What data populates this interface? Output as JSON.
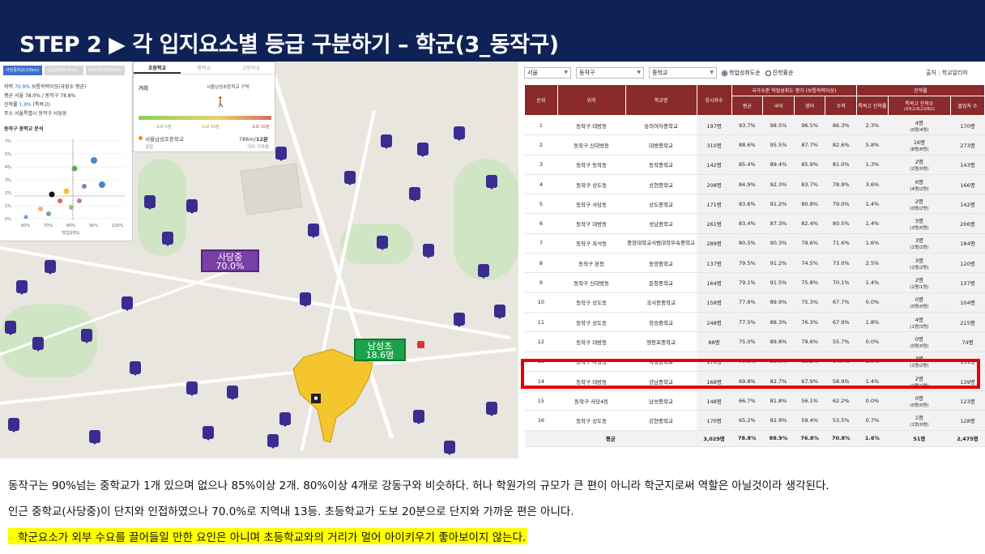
{
  "title": "STEP 2 ▶ 각 입지요소별 등급 구분하기 – 학군(3_동작구)",
  "left_panel": {
    "tabs": [
      "사당중학교(15km)",
      "성도중학교(3km)",
      "동작구중학교(8km)"
    ],
    "line1_prefix": "학력",
    "line1_value": "70.9%",
    "line1_suffix": "보통학력이상(국영수 평균)",
    "line2": "평균 서울 78.0% / 동작구 78.8%",
    "line3_prefix": "진학률",
    "line3_value": "1.9%",
    "line3_suffix": "(특목고)",
    "line4": "주소 서울특별시 동작구 사당동",
    "chart_title": "동작구 중학교 분석",
    "chart_xlabel": "학업성취도"
  },
  "school_panel": {
    "tabs": [
      "초등학교",
      "중학교",
      "고등학교"
    ],
    "distance_label": "거리",
    "school_route": "서울남성초등학교 구역",
    "legend": [
      "도보 5분",
      "도보 10분",
      "도보 20분"
    ],
    "school_name": "서울남성초등학교",
    "distance_value": "786m",
    "walk_time": "12분",
    "school_type": "공립",
    "walk_note": "거리 가까움"
  },
  "map": {
    "label_sadang_name": "사당중",
    "label_sadang_value": "70.0%",
    "label_namseong_name": "남성초",
    "label_namseong_value": "18.6명",
    "colors": {
      "sadang": "#7b3fa8",
      "namseong": "#1ca24a",
      "zone": "#f5c52e",
      "pin": "#3a2d8f"
    }
  },
  "table_panel": {
    "filter_city": "서울",
    "filter_district": "동작구",
    "filter_level": "중학교",
    "radio_1": "학업성취도순",
    "radio_2": "진학률순",
    "source": "출처 : 학교알리미",
    "headers": {
      "rank": "순위",
      "location": "위치",
      "school": "학교명",
      "applicants": "응시자수",
      "group_achievement": "국가수준 학업성취도 평가 (보통학력이상)",
      "group_progress": "진학률",
      "avg": "평균",
      "korean": "국어",
      "english": "영어",
      "math": "수학",
      "special_rate": "특목고 진학률",
      "special_count": "특목고 진학수",
      "special_count_sub": "(과학고/외고국제고)",
      "grad": "졸업자 수"
    },
    "rows": [
      {
        "rank": "1",
        "loc": "동작구 대방동",
        "school": "숭의여자중학교",
        "app": "197명",
        "avg": "93.7%",
        "kor": "98.5%",
        "eng": "96.5%",
        "math": "86.3%",
        "rate": "2.3%",
        "cnt": "4명",
        "cnt_sub": "(0명/4명)",
        "grad": "170명"
      },
      {
        "rank": "2",
        "loc": "동작구 신대방동",
        "school": "대방중학교",
        "app": "310명",
        "avg": "88.6%",
        "kor": "95.5%",
        "eng": "87.7%",
        "math": "82.6%",
        "rate": "5.8%",
        "cnt": "16명",
        "cnt_sub": "(8명/8명)",
        "grad": "273명"
      },
      {
        "rank": "3",
        "loc": "동작구 동작동",
        "school": "동작중학교",
        "app": "142명",
        "avg": "85.4%",
        "kor": "89.4%",
        "eng": "85.9%",
        "math": "81.0%",
        "rate": "1.3%",
        "cnt": "2명",
        "cnt_sub": "(2명/0명)",
        "grad": "143명"
      },
      {
        "rank": "4",
        "loc": "동작구 상도동",
        "school": "상현중학교",
        "app": "208명",
        "avg": "84.9%",
        "kor": "92.3%",
        "eng": "83.7%",
        "math": "78.9%",
        "rate": "3.6%",
        "cnt": "6명",
        "cnt_sub": "(4명/2명)",
        "grad": "166명"
      },
      {
        "rank": "5",
        "loc": "동작구 사당동",
        "school": "상도중학교",
        "app": "171명",
        "avg": "83.6%",
        "kor": "91.2%",
        "eng": "80.8%",
        "math": "79.0%",
        "rate": "1.4%",
        "cnt": "2명",
        "cnt_sub": "(0명/2명)",
        "grad": "142명"
      },
      {
        "rank": "6",
        "loc": "동작구 대방동",
        "school": "성남중학교",
        "app": "261명",
        "avg": "83.4%",
        "kor": "87.3%",
        "eng": "82.4%",
        "math": "80.5%",
        "rate": "1.4%",
        "cnt": "3명",
        "cnt_sub": "(3명/0명)",
        "grad": "206명"
      },
      {
        "rank": "7",
        "loc": "동작구 흑석동",
        "school": "중앙대학교사범대학부속중학교",
        "app": "289명",
        "avg": "80.5%",
        "kor": "90.3%",
        "eng": "79.6%",
        "math": "71.6%",
        "rate": "1.6%",
        "cnt": "3명",
        "cnt_sub": "(1명/2명)",
        "grad": "184명"
      },
      {
        "rank": "8",
        "loc": "동작구 본동",
        "school": "동양중학교",
        "app": "137명",
        "avg": "79.5%",
        "kor": "91.2%",
        "eng": "74.5%",
        "math": "73.0%",
        "rate": "2.5%",
        "cnt": "3명",
        "cnt_sub": "(1명/2명)",
        "grad": "120명"
      },
      {
        "rank": "9",
        "loc": "동작구 신대방동",
        "school": "문창중학교",
        "app": "164명",
        "avg": "79.1%",
        "kor": "91.5%",
        "eng": "75.8%",
        "math": "70.1%",
        "rate": "1.4%",
        "cnt": "2명",
        "cnt_sub": "(1명/1명)",
        "grad": "137명"
      },
      {
        "rank": "10",
        "loc": "동작구 상도동",
        "school": "국사봉중학교",
        "app": "158명",
        "avg": "77.6%",
        "kor": "89.9%",
        "eng": "75.3%",
        "math": "67.7%",
        "rate": "0.0%",
        "cnt": "0명",
        "cnt_sub": "(0명/0명)",
        "grad": "104명"
      },
      {
        "rank": "11",
        "loc": "동작구 상도동",
        "school": "장승중학교",
        "app": "248명",
        "avg": "77.5%",
        "kor": "88.3%",
        "eng": "76.3%",
        "math": "67.9%",
        "rate": "1.8%",
        "cnt": "4명",
        "cnt_sub": "(1명/3명)",
        "grad": "215명"
      },
      {
        "rank": "12",
        "loc": "동작구 대방동",
        "school": "영등포중학교",
        "app": "88명",
        "avg": "75.0%",
        "kor": "89.8%",
        "eng": "79.6%",
        "math": "55.7%",
        "rate": "0.0%",
        "cnt": "0명",
        "cnt_sub": "(0명/0명)",
        "grad": "74명"
      },
      {
        "rank": "13",
        "loc": "동작구 사당동",
        "school": "사당중학교",
        "app": "170명",
        "avg": "70.9%",
        "kor": "80.0%",
        "eng": "68.2%",
        "math": "64.7%",
        "rate": "1.9%",
        "cnt": "3명",
        "cnt_sub": "(1명/2명)",
        "grad": "151명"
      },
      {
        "rank": "14",
        "loc": "동작구 대방동",
        "school": "강남중학교",
        "app": "168명",
        "avg": "69.8%",
        "kor": "82.7%",
        "eng": "67.9%",
        "math": "58.9%",
        "rate": "1.4%",
        "cnt": "2명",
        "cnt_sub": "(1명/1명)",
        "grad": "139명"
      },
      {
        "rank": "15",
        "loc": "동작구 사당4동",
        "school": "남성중학교",
        "app": "148명",
        "avg": "66.7%",
        "kor": "81.8%",
        "eng": "56.1%",
        "math": "62.2%",
        "rate": "0.0%",
        "cnt": "0명",
        "cnt_sub": "(0명/0명)",
        "grad": "123명"
      },
      {
        "rank": "16",
        "loc": "동작구 상도동",
        "school": "강현중학교",
        "app": "170명",
        "avg": "65.2%",
        "kor": "82.9%",
        "eng": "59.4%",
        "math": "53.5%",
        "rate": "0.7%",
        "cnt": "1명",
        "cnt_sub": "(1명/0명)",
        "grad": "128명"
      }
    ],
    "footer": {
      "label": "평균",
      "app": "3,029명",
      "avg": "78.8%",
      "kor": "88.9%",
      "eng": "76.8%",
      "math": "70.8%",
      "rate": "1.6%",
      "cnt": "51명",
      "grad": "2,475명"
    },
    "highlight_color": "#e60000",
    "header_color": "#8a2a2a"
  },
  "bottom": {
    "line1": "동작구는 90%넘는 중학교가 1개 있으며 없으나 85%이상 2개. 80%이상 4개로 강동구와 비슷하다. 허나 학원가의 규모가 큰 편이 아니라 학군지로써 역할은 아닐것이라 생각된다.",
    "line2": "인근 중학교(사당중)이 단지와 인접하였으나 70.0%로 지역내 13등. 초등학교가 도보 20분으로 단지와 가까운 편은 아니다.",
    "line3_mark": "☞",
    "line3": "학군요소가 외부 수요를 끌어들일 만한 요인은 아니며 초등학교와의 거리가 멀어 아이키우기 좋아보이지 않는다."
  }
}
